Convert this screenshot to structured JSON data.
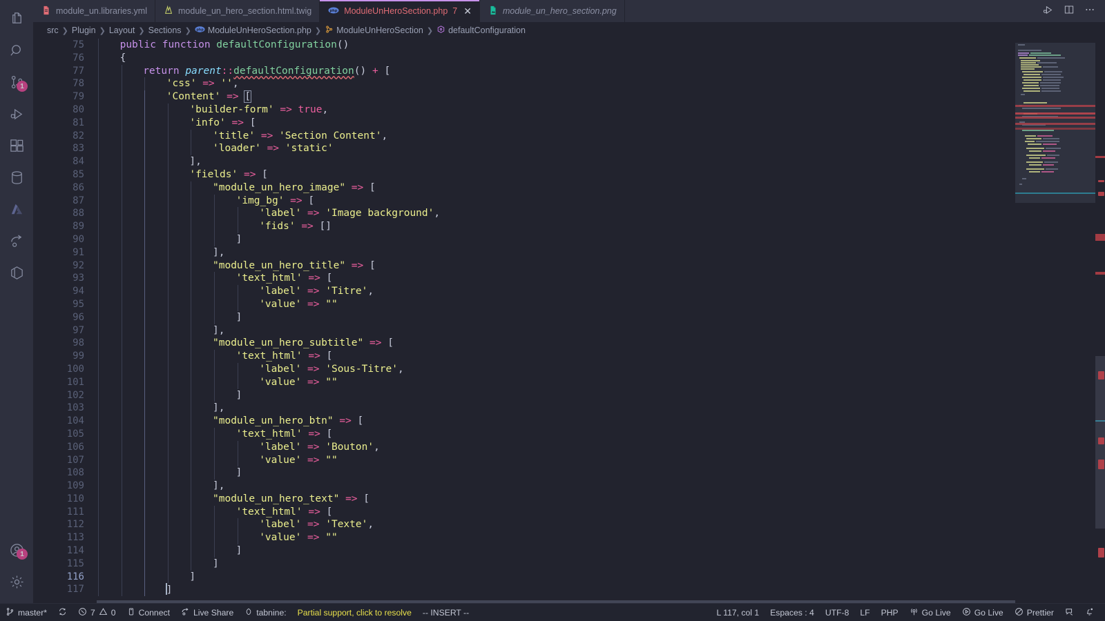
{
  "window": {
    "theme_bg": "#22232e",
    "accent": "#c792ea",
    "error_color": "#e06c75",
    "badge_color": "#ec4899"
  },
  "activity_bar": {
    "items": [
      {
        "name": "explorer",
        "icon": "files-icon",
        "badge": ""
      },
      {
        "name": "search",
        "icon": "search-icon",
        "badge": ""
      },
      {
        "name": "source-control",
        "icon": "source-control-icon",
        "badge": "1"
      },
      {
        "name": "run-and-debug",
        "icon": "run-debug-icon",
        "badge": ""
      },
      {
        "name": "extensions",
        "icon": "extensions-icon",
        "badge": ""
      },
      {
        "name": "database",
        "icon": "database-icon",
        "badge": ""
      },
      {
        "name": "azure",
        "icon": "azure-icon",
        "badge": ""
      },
      {
        "name": "live-share",
        "icon": "live-share-icon",
        "badge": ""
      },
      {
        "name": "docker",
        "icon": "docker-cube-icon",
        "badge": ""
      }
    ],
    "bottom_items": [
      {
        "name": "accounts",
        "icon": "account-icon",
        "badge": "1"
      },
      {
        "name": "settings",
        "icon": "gear-icon",
        "badge": ""
      }
    ]
  },
  "tabs": [
    {
      "label": "module_un.libraries.yml",
      "icon": "yaml-file-icon",
      "active": false,
      "italic": false,
      "errors": "",
      "closable": false
    },
    {
      "label": "module_un_hero_section.html.twig",
      "icon": "twig-file-icon",
      "active": false,
      "italic": false,
      "errors": "",
      "closable": false
    },
    {
      "label": "ModuleUnHeroSection.php",
      "icon": "php-file-icon",
      "active": true,
      "italic": false,
      "errors": "7",
      "closable": true
    },
    {
      "label": "module_un_hero_section.png",
      "icon": "image-file-icon",
      "active": false,
      "italic": true,
      "errors": "",
      "closable": false
    }
  ],
  "tab_actions": [
    {
      "name": "run-or-debug-file",
      "icon": "run-debug-icon"
    },
    {
      "name": "split-editor",
      "icon": "split-editor-icon"
    },
    {
      "name": "more-actions",
      "icon": "ellipsis-icon"
    }
  ],
  "breadcrumb": [
    {
      "label": "src",
      "icon": ""
    },
    {
      "label": "Plugin",
      "icon": ""
    },
    {
      "label": "Layout",
      "icon": ""
    },
    {
      "label": "Sections",
      "icon": ""
    },
    {
      "label": "ModuleUnHeroSection.php",
      "icon": "php-file-icon"
    },
    {
      "label": "ModuleUnHeroSection",
      "icon": "class-icon"
    },
    {
      "label": "defaultConfiguration",
      "icon": "method-icon"
    }
  ],
  "editor": {
    "language": "PHP",
    "first_line": 75,
    "lines": [
      {
        "n": 75,
        "indent": 1,
        "text": "public function defaultConfiguration()"
      },
      {
        "n": 76,
        "indent": 1,
        "text": "{"
      },
      {
        "n": 77,
        "indent": 2,
        "text": "return parent::defaultConfiguration() + ["
      },
      {
        "n": 78,
        "indent": 3,
        "text": "'css' => '',"
      },
      {
        "n": 79,
        "indent": 3,
        "text": "'Content' => ["
      },
      {
        "n": 80,
        "indent": 4,
        "text": "'builder-form' => true,"
      },
      {
        "n": 81,
        "indent": 4,
        "text": "'info' => ["
      },
      {
        "n": 82,
        "indent": 5,
        "text": "'title' => 'Section Content',"
      },
      {
        "n": 83,
        "indent": 5,
        "text": "'loader' => 'static'"
      },
      {
        "n": 84,
        "indent": 4,
        "text": "],"
      },
      {
        "n": 85,
        "indent": 4,
        "text": "'fields' => ["
      },
      {
        "n": 86,
        "indent": 5,
        "text": "\"module_un_hero_image\" => ["
      },
      {
        "n": 87,
        "indent": 6,
        "text": "'img_bg' => ["
      },
      {
        "n": 88,
        "indent": 7,
        "text": "'label' => 'Image background',"
      },
      {
        "n": 89,
        "indent": 7,
        "text": "'fids' => []"
      },
      {
        "n": 90,
        "indent": 6,
        "text": "]"
      },
      {
        "n": 91,
        "indent": 5,
        "text": "],"
      },
      {
        "n": 92,
        "indent": 5,
        "text": "\"module_un_hero_title\" => ["
      },
      {
        "n": 93,
        "indent": 6,
        "text": "'text_html' => ["
      },
      {
        "n": 94,
        "indent": 7,
        "text": "'label' => 'Titre',"
      },
      {
        "n": 95,
        "indent": 7,
        "text": "'value' => \"\""
      },
      {
        "n": 96,
        "indent": 6,
        "text": "]"
      },
      {
        "n": 97,
        "indent": 5,
        "text": "],"
      },
      {
        "n": 98,
        "indent": 5,
        "text": "\"module_un_hero_subtitle\" => ["
      },
      {
        "n": 99,
        "indent": 6,
        "text": "'text_html' => ["
      },
      {
        "n": 100,
        "indent": 7,
        "text": "'label' => 'Sous-Titre',"
      },
      {
        "n": 101,
        "indent": 7,
        "text": "'value' => \"\""
      },
      {
        "n": 102,
        "indent": 6,
        "text": "]"
      },
      {
        "n": 103,
        "indent": 5,
        "text": "],"
      },
      {
        "n": 104,
        "indent": 5,
        "text": "\"module_un_hero_btn\" => ["
      },
      {
        "n": 105,
        "indent": 6,
        "text": "'text_html' => ["
      },
      {
        "n": 106,
        "indent": 7,
        "text": "'label' => 'Bouton',"
      },
      {
        "n": 107,
        "indent": 7,
        "text": "'value' => \"\""
      },
      {
        "n": 108,
        "indent": 6,
        "text": "]"
      },
      {
        "n": 109,
        "indent": 5,
        "text": "],"
      },
      {
        "n": 110,
        "indent": 5,
        "text": "\"module_un_hero_text\" => ["
      },
      {
        "n": 111,
        "indent": 6,
        "text": "'text_html' => ["
      },
      {
        "n": 112,
        "indent": 7,
        "text": "'label' => 'Texte',"
      },
      {
        "n": 113,
        "indent": 7,
        "text": "'value' => \"\""
      },
      {
        "n": 114,
        "indent": 6,
        "text": "]"
      },
      {
        "n": 115,
        "indent": 5,
        "text": "]"
      },
      {
        "n": 116,
        "indent": 4,
        "text": "]"
      },
      {
        "n": 117,
        "indent": 3,
        "text": "]"
      }
    ]
  },
  "status_bar": {
    "left": [
      {
        "name": "branch",
        "icon": "git-branch-icon",
        "label": "master*",
        "warn": false
      },
      {
        "name": "sync",
        "icon": "sync-icon",
        "label": "",
        "warn": false
      },
      {
        "name": "problems",
        "icon": "error-icon",
        "label": "7",
        "warn": false,
        "second_icon": "warning-icon",
        "second_label": "0"
      },
      {
        "name": "remote",
        "icon": "remote-icon",
        "label": "Connect",
        "warn": false
      },
      {
        "name": "live-share",
        "icon": "live-share-icon",
        "label": "Live Share",
        "warn": false
      },
      {
        "name": "tabnine",
        "icon": "tabnine-icon",
        "label": "tabnine:",
        "warn": false
      },
      {
        "name": "tabnine-status",
        "icon": "",
        "label": "Partial support, click to resolve",
        "warn": true
      },
      {
        "name": "vim-mode",
        "icon": "",
        "label": "-- INSERT --",
        "warn": false
      }
    ],
    "right": [
      {
        "name": "cursor-position",
        "icon": "",
        "label": "L 117, col 1"
      },
      {
        "name": "indentation",
        "icon": "",
        "label": "Espaces : 4"
      },
      {
        "name": "encoding",
        "icon": "",
        "label": "UTF-8"
      },
      {
        "name": "eol",
        "icon": "",
        "label": "LF"
      },
      {
        "name": "language-mode",
        "icon": "",
        "label": "PHP"
      },
      {
        "name": "go-live-server",
        "icon": "broadcast-icon",
        "label": "Go Live"
      },
      {
        "name": "go-live-preview",
        "icon": "play-icon",
        "label": "Go Live"
      },
      {
        "name": "prettier",
        "icon": "prettier-icon",
        "label": "Prettier"
      },
      {
        "name": "feedback",
        "icon": "feedback-icon",
        "label": ""
      },
      {
        "name": "notifications",
        "icon": "bell-icon",
        "label": ""
      }
    ]
  }
}
